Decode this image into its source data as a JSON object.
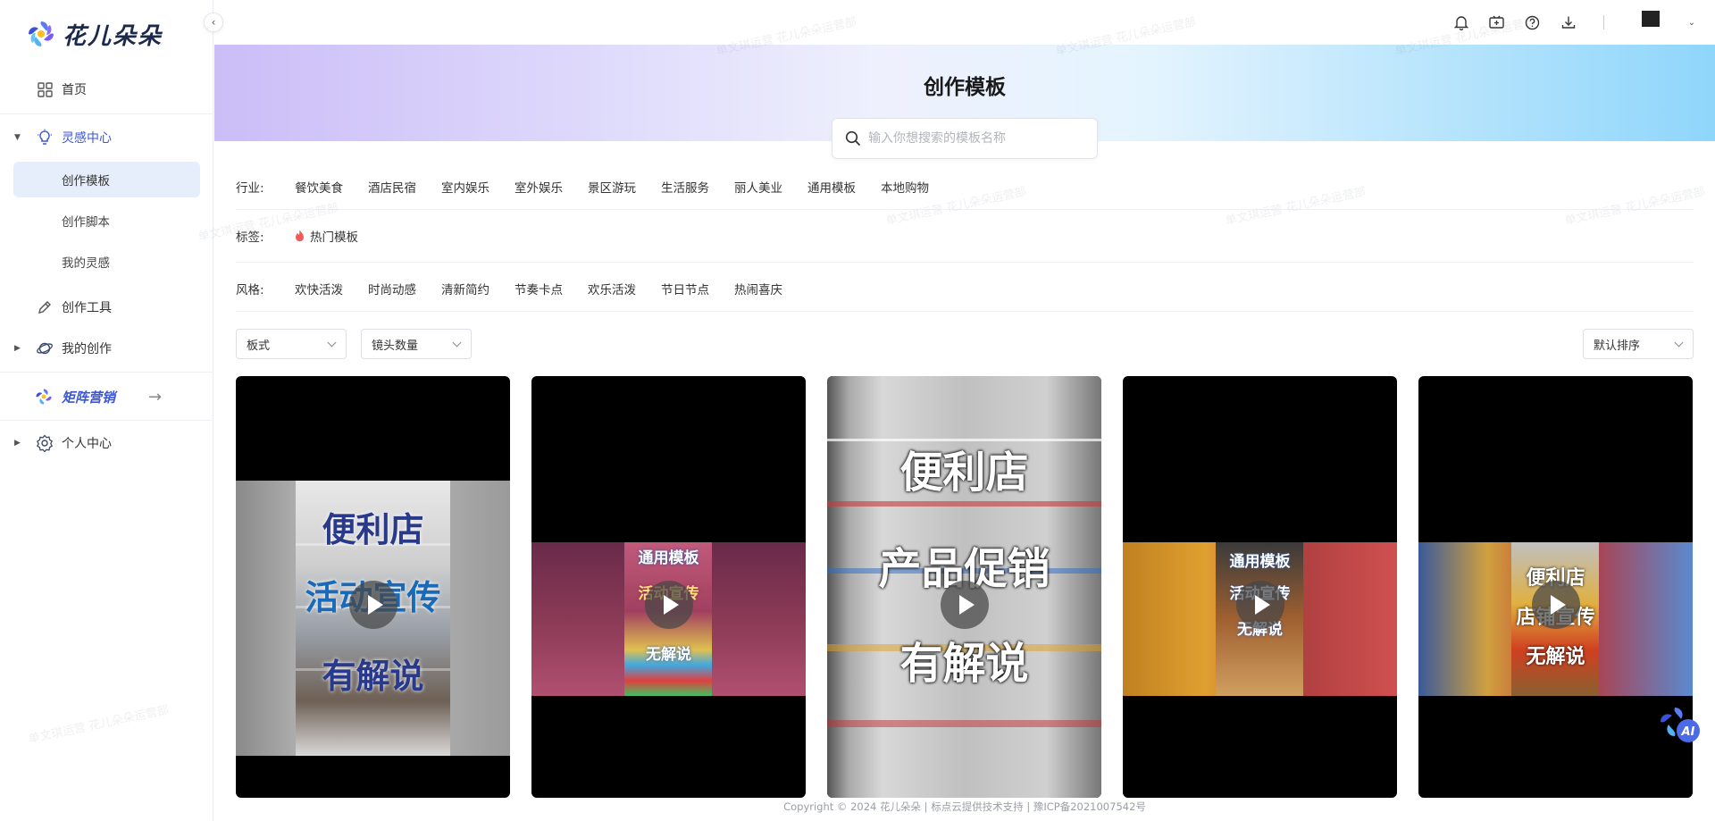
{
  "brand": {
    "name": "花儿朵朵"
  },
  "sidebar": {
    "home": "首页",
    "inspiration": "灵感中心",
    "sub": [
      "创作模板",
      "创作脚本",
      "我的灵感"
    ],
    "tools": "创作工具",
    "my_creation": "我的创作",
    "matrix": "矩阵营销",
    "personal": "个人中心"
  },
  "topbar": {
    "icons": [
      "bell-icon",
      "video-plus-icon",
      "help-icon",
      "download-icon"
    ]
  },
  "banner": {
    "title": "创作模板"
  },
  "search": {
    "placeholder": "输入你想搜索的模板名称"
  },
  "filters": {
    "industry": {
      "label": "行业:",
      "items": [
        "餐饮美食",
        "酒店民宿",
        "室内娱乐",
        "室外娱乐",
        "景区游玩",
        "生活服务",
        "丽人美业",
        "通用模板",
        "本地购物"
      ]
    },
    "tags": {
      "label": "标签:",
      "items": [
        "热门模板"
      ]
    },
    "style": {
      "label": "风格:",
      "items": [
        "欢快活泼",
        "时尚动感",
        "清新简约",
        "节奏卡点",
        "欢乐活泼",
        "节日节点",
        "热闹喜庆"
      ]
    }
  },
  "selects": {
    "format": "板式",
    "shots": "镜头数量",
    "sort": "默认排序"
  },
  "cards": [
    {
      "lines": [
        "便利店",
        "活动宣传",
        "有解说"
      ]
    },
    {
      "lines": [
        "通用模板",
        "活动宣传",
        "无解说"
      ]
    },
    {
      "lines": [
        "便利店",
        "产品促销",
        "有解说"
      ]
    },
    {
      "lines": [
        "通用模板",
        "活动宣传",
        "无解说"
      ]
    },
    {
      "lines": [
        "便利店",
        "店铺宣传",
        "无解说"
      ]
    }
  ],
  "footer": "Copyright © 2024 花儿朵朵 | 标点云提供技术支持 | 豫ICP备2021007542号",
  "watermark": "单文琪运营 花儿朵朵运营部",
  "colors": {
    "accent": "#3d56d6",
    "active_bg": "#e6eefb",
    "hot": "#f25a5a"
  }
}
